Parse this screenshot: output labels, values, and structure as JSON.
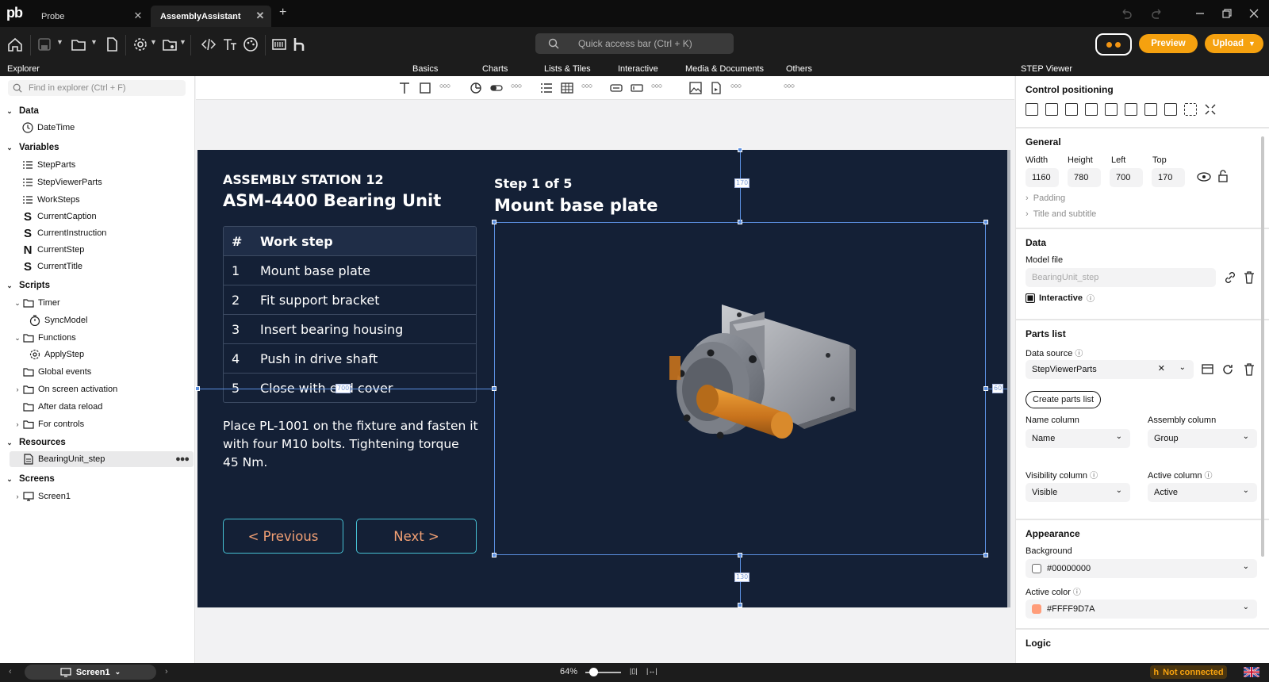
{
  "app": {
    "logo": "pb"
  },
  "tabs": [
    {
      "label": "Probe",
      "active": false
    },
    {
      "label": "AssemblyAssistant",
      "active": true
    }
  ],
  "toolbar": {
    "quick_access_placeholder": "Quick access bar (Ctrl + K)",
    "preview_label": "Preview",
    "upload_label": "Upload"
  },
  "header": {
    "explorer": "Explorer",
    "categories": [
      "Basics",
      "Charts",
      "Lists & Tiles",
      "Interactive",
      "Media & Documents",
      "Others"
    ],
    "properties": "STEP Viewer"
  },
  "explorer": {
    "search_placeholder": "Find in explorer (Ctrl + F)",
    "sections": {
      "data": "Data",
      "variables": "Variables",
      "scripts": "Scripts",
      "resources": "Resources",
      "screens": "Screens"
    },
    "data_items": [
      "DateTime"
    ],
    "variable_items": [
      "StepParts",
      "StepViewerParts",
      "WorkSteps",
      "CurrentCaption",
      "CurrentInstruction",
      "CurrentStep",
      "CurrentTitle"
    ],
    "scripts": {
      "timer": "Timer",
      "sync": "SyncModel",
      "functions": "Functions",
      "apply": "ApplyStep",
      "global": "Global events",
      "onscreen": "On screen activation",
      "afterreload": "After data reload",
      "forcontrols": "For controls"
    },
    "resource_items": [
      "BearingUnit_step"
    ],
    "screen_items": [
      "Screen1"
    ]
  },
  "screen": {
    "station": "ASSEMBLY STATION 12",
    "unit": "ASM-4400 Bearing Unit",
    "step_counter": "Step 1 of 5",
    "step_title": "Mount base plate",
    "table": {
      "headers": [
        "#",
        "Work step"
      ],
      "rows": [
        [
          "1",
          "Mount base plate"
        ],
        [
          "2",
          "Fit support bracket"
        ],
        [
          "3",
          "Insert bearing housing"
        ],
        [
          "4",
          "Push in drive shaft"
        ],
        [
          "5",
          "Close with end cover"
        ]
      ]
    },
    "instruction": "Place PL-1001 on the fixture and fasten it with four M10 bolts. Tightening torque 45 Nm.",
    "prev_label": "< Previous",
    "next_label": "Next >",
    "guide_labels": {
      "top": "170",
      "left": "700",
      "right": "60",
      "bottom": "130"
    }
  },
  "properties": {
    "control_positioning": "Control positioning",
    "general": {
      "title": "General",
      "labels": [
        "Width",
        "Height",
        "Left",
        "Top"
      ],
      "values": [
        "1160",
        "780",
        "700",
        "170"
      ],
      "padding": "Padding",
      "title_subtitle": "Title and subtitle"
    },
    "data": {
      "title": "Data",
      "model_file_label": "Model file",
      "model_file_value": "BearingUnit_step",
      "interactive_label": "Interactive"
    },
    "parts_list": {
      "title": "Parts list",
      "data_source_label": "Data source",
      "data_source_value": "StepViewerParts",
      "create_label": "Create parts list",
      "name_column_label": "Name column",
      "name_column_value": "Name",
      "assembly_column_label": "Assembly column",
      "assembly_column_value": "Group",
      "visibility_column_label": "Visibility column",
      "visibility_column_value": "Visible",
      "active_column_label": "Active column",
      "active_column_value": "Active"
    },
    "appearance": {
      "title": "Appearance",
      "background_label": "Background",
      "background_value": "#00000000",
      "active_color_label": "Active color",
      "active_color_value": "#FFFF9D7A"
    },
    "logic": "Logic"
  },
  "statusbar": {
    "screen": "Screen1",
    "zoom": "64%",
    "connection": "Not connected"
  },
  "colors": {
    "accent": "#f5a10f",
    "screen_bg": "#142036",
    "button_border": "#46c0d3",
    "button_text": "#f2a074",
    "active_color": "#FF9D7A"
  }
}
